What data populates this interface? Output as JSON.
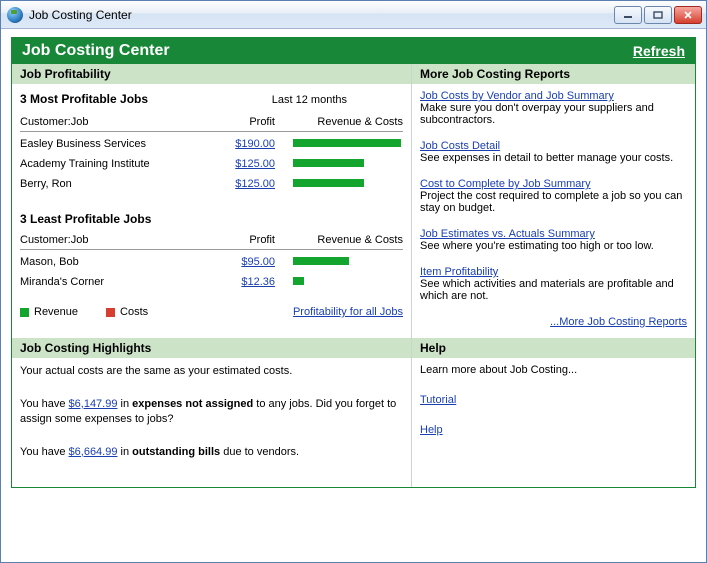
{
  "window": {
    "title": "Job Costing Center"
  },
  "header": {
    "title": "Job Costing Center",
    "refresh": "Refresh"
  },
  "profitability": {
    "section": "Job Profitability",
    "most_title": "3 Most Profitable Jobs",
    "period": "Last 12 months",
    "cols": {
      "customer": "Customer:Job",
      "profit": "Profit",
      "rc": "Revenue & Costs"
    },
    "most": [
      {
        "name": "Easley Business Services",
        "profit": "$190.00",
        "rev": 100,
        "cost": 0
      },
      {
        "name": "Academy Training Institute",
        "profit": "$125.00",
        "rev": 66,
        "cost": 0
      },
      {
        "name": "Berry, Ron",
        "profit": "$125.00",
        "rev": 66,
        "cost": 0
      }
    ],
    "least_title": "3 Least Profitable Jobs",
    "least": [
      {
        "name": "Mason, Bob",
        "profit": "$95.00",
        "rev": 52,
        "cost": 0
      },
      {
        "name": "Miranda's Corner",
        "profit": "$12.36",
        "rev": 10,
        "cost": 0
      }
    ],
    "legend": {
      "rev": "Revenue",
      "cost": "Costs"
    },
    "all_link": "Profitability for all Jobs"
  },
  "reports": {
    "section": "More Job Costing Reports",
    "items": [
      {
        "link": "Job Costs by Vendor and Job Summary",
        "desc": "Make sure you don't overpay your suppliers and subcontractors."
      },
      {
        "link": "Job Costs Detail",
        "desc": "See expenses in detail to better manage your costs."
      },
      {
        "link": "Cost to Complete by Job Summary",
        "desc": "Project the cost required to complete a job so you can stay on budget."
      },
      {
        "link": "Job Estimates vs. Actuals Summary",
        "desc": "See where you're estimating too high or too low."
      },
      {
        "link": "Item Profitability",
        "desc": "See which activities and materials are profitable and which are not."
      }
    ],
    "more": "...More Job Costing Reports"
  },
  "highlights": {
    "section": "Job Costing Highlights",
    "line1": "Your actual costs are the same as your estimated costs.",
    "line2_a": "You have ",
    "line2_amt": "$6,147.99",
    "line2_b": " in ",
    "line2_bold": "expenses not assigned",
    "line2_c": " to any jobs. Did you forget to assign some expenses to jobs?",
    "line3_a": "You have ",
    "line3_amt": "$6,664.99",
    "line3_b": " in ",
    "line3_bold": "outstanding bills",
    "line3_c": " due to vendors."
  },
  "help": {
    "section": "Help",
    "intro": "Learn more about Job Costing...",
    "tutorial": "Tutorial",
    "help": "Help"
  }
}
